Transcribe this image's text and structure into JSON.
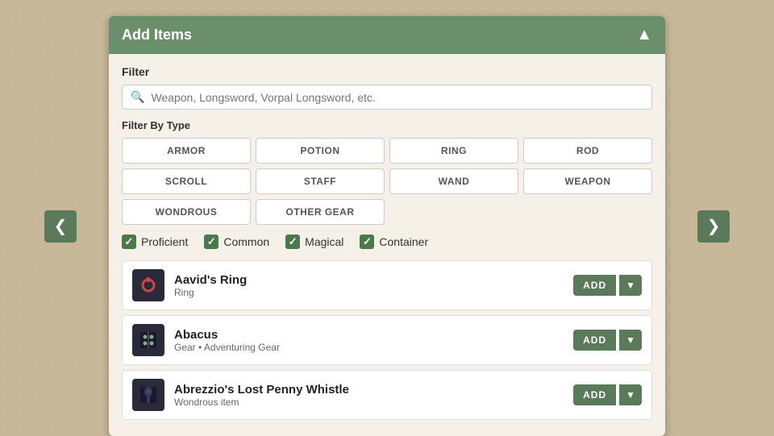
{
  "panel": {
    "header": {
      "title": "Add Items",
      "chevron": "▲"
    },
    "filter": {
      "label": "Filter",
      "search_placeholder": "Weapon, Longsword, Vorpal Longsword, etc."
    },
    "filter_by_type": {
      "label": "Filter By Type",
      "buttons": [
        {
          "id": "armor",
          "label": "ARMOR"
        },
        {
          "id": "potion",
          "label": "POTION"
        },
        {
          "id": "ring",
          "label": "RING"
        },
        {
          "id": "rod",
          "label": "ROD"
        },
        {
          "id": "scroll",
          "label": "SCROLL"
        },
        {
          "id": "staff",
          "label": "STAFF"
        },
        {
          "id": "wand",
          "label": "WAND"
        },
        {
          "id": "weapon",
          "label": "WEAPON"
        },
        {
          "id": "wondrous",
          "label": "WONDROUS"
        },
        {
          "id": "other-gear",
          "label": "OTHER GEAR"
        }
      ]
    },
    "checkboxes": [
      {
        "id": "proficient",
        "label": "Proficient",
        "checked": true
      },
      {
        "id": "common",
        "label": "Common",
        "checked": true
      },
      {
        "id": "magical",
        "label": "Magical",
        "checked": true
      },
      {
        "id": "container",
        "label": "Container",
        "checked": true
      }
    ],
    "items": [
      {
        "id": "aavids-ring",
        "name": "Aavid's Ring",
        "sub": "Ring",
        "add_label": "ADD"
      },
      {
        "id": "abacus",
        "name": "Abacus",
        "sub": "Gear • Adventuring Gear",
        "add_label": "ADD"
      },
      {
        "id": "abrezzios-penny-whistle",
        "name": "Abrezzio's Lost Penny Whistle",
        "sub": "Wondrous item",
        "add_label": "ADD"
      }
    ]
  },
  "nav": {
    "left_arrow": "❮",
    "right_arrow": "❯"
  }
}
